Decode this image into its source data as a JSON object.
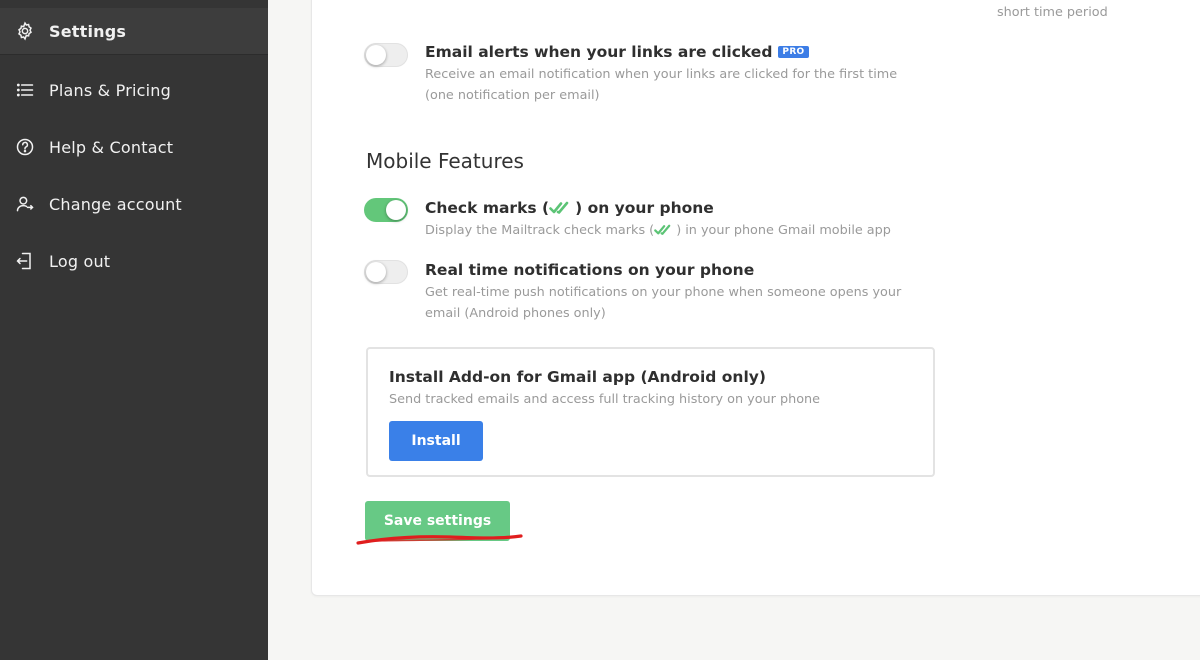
{
  "sidebar": {
    "items": [
      {
        "label": "Settings",
        "icon": "gear-icon",
        "active": true
      },
      {
        "label": "Plans & Pricing",
        "icon": "list-icon"
      },
      {
        "label": "Help & Contact",
        "icon": "help-circle-icon"
      },
      {
        "label": "Change account",
        "icon": "user-switch-icon"
      },
      {
        "label": "Log out",
        "icon": "logout-icon"
      }
    ]
  },
  "main": {
    "top_fragment": "short time period",
    "email_alerts": {
      "title": "Email alerts when your links are clicked",
      "badge": "PRO",
      "desc_line1": "Receive an email notification when your links are clicked for the first time",
      "desc_line2": "(one notification per email)",
      "enabled": false
    },
    "mobile_section_title": "Mobile Features",
    "check_marks": {
      "title_before": "Check marks (",
      "title_after": ") on your phone",
      "desc_before": "Display the Mailtrack check marks (",
      "desc_after": ") in your phone Gmail mobile app",
      "enabled": true
    },
    "realtime": {
      "title": "Real time notifications on your phone",
      "desc_line1": "Get real-time push notifications on your phone when someone opens your",
      "desc_line2": "email (Android phones only)",
      "enabled": false
    },
    "addon": {
      "title": "Install Add-on for Gmail app (Android only)",
      "desc": "Send tracked emails and access full tracking history on your phone",
      "button": "Install"
    },
    "save_button": "Save settings"
  },
  "colors": {
    "sidebar_bg": "#353535",
    "toggle_on": "#63c77a",
    "install_blue": "#3a80e8",
    "save_green": "#67c985",
    "annotation_red": "#e01e1e"
  }
}
